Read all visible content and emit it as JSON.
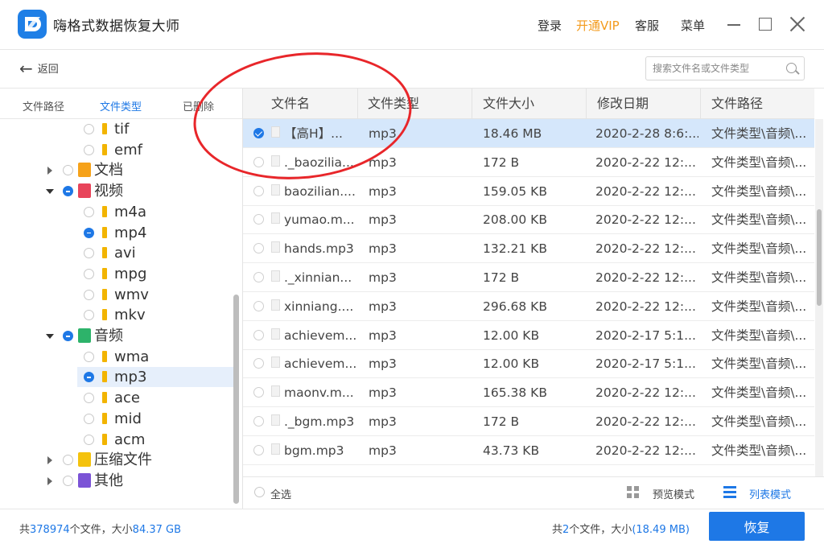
{
  "app": {
    "title": "嗨格式数据恢复大师"
  },
  "header": {
    "login": "登录",
    "vip": "开通VIP",
    "service": "客服",
    "menu": "菜单"
  },
  "toolbar": {
    "back": "返回",
    "search_placeholder": "搜索文件名或文件类型"
  },
  "sidebar": {
    "tabs": [
      "文件路径",
      "文件类型",
      "已删除"
    ],
    "active_tab": "文件类型",
    "tree": [
      {
        "label": "tif",
        "level": 2,
        "icon": "folder-icon"
      },
      {
        "label": "emf",
        "level": 2,
        "icon": "folder-icon"
      },
      {
        "label": "文档",
        "level": 1,
        "icon": "document-category-icon",
        "expanded": false
      },
      {
        "label": "视频",
        "level": 1,
        "icon": "video-category-icon",
        "expanded": true,
        "state": "partial"
      },
      {
        "label": "m4a",
        "level": 2,
        "icon": "folder-icon"
      },
      {
        "label": "mp4",
        "level": 2,
        "icon": "folder-icon",
        "state": "partial"
      },
      {
        "label": "avi",
        "level": 2,
        "icon": "folder-icon"
      },
      {
        "label": "mpg",
        "level": 2,
        "icon": "folder-icon"
      },
      {
        "label": "wmv",
        "level": 2,
        "icon": "folder-icon"
      },
      {
        "label": "mkv",
        "level": 2,
        "icon": "folder-icon"
      },
      {
        "label": "音频",
        "level": 1,
        "icon": "audio-category-icon",
        "expanded": true,
        "state": "partial"
      },
      {
        "label": "wma",
        "level": 2,
        "icon": "folder-icon"
      },
      {
        "label": "mp3",
        "level": 2,
        "icon": "folder-icon",
        "state": "partial",
        "selected": true
      },
      {
        "label": "ace",
        "level": 2,
        "icon": "folder-icon"
      },
      {
        "label": "mid",
        "level": 2,
        "icon": "folder-icon"
      },
      {
        "label": "acm",
        "level": 2,
        "icon": "folder-icon"
      },
      {
        "label": "压缩文件",
        "level": 1,
        "icon": "archive-category-icon",
        "expanded": false
      },
      {
        "label": "其他",
        "level": 1,
        "icon": "other-category-icon",
        "expanded": false
      }
    ]
  },
  "table": {
    "columns": [
      "文件名",
      "文件类型",
      "文件大小",
      "修改日期",
      "文件路径"
    ],
    "rows": [
      {
        "name": "【高H】...",
        "type": "mp3",
        "size": "18.46 MB",
        "date": "2020-2-28 8:6:...",
        "path": "文件类型\\音频\\...",
        "checked": true
      },
      {
        "name": "._baozilia...",
        "type": "mp3",
        "size": "172 B",
        "date": "2020-2-22 12:...",
        "path": "文件类型\\音频\\..."
      },
      {
        "name": "baozilian....",
        "type": "mp3",
        "size": "159.05 KB",
        "date": "2020-2-22 12:...",
        "path": "文件类型\\音频\\..."
      },
      {
        "name": "yumao.m...",
        "type": "mp3",
        "size": "208.00 KB",
        "date": "2020-2-22 12:...",
        "path": "文件类型\\音频\\..."
      },
      {
        "name": "hands.mp3",
        "type": "mp3",
        "size": "132.21 KB",
        "date": "2020-2-22 12:...",
        "path": "文件类型\\音频\\..."
      },
      {
        "name": "._xinnian...",
        "type": "mp3",
        "size": "172 B",
        "date": "2020-2-22 12:...",
        "path": "文件类型\\音频\\..."
      },
      {
        "name": "xinniang....",
        "type": "mp3",
        "size": "296.68 KB",
        "date": "2020-2-22 12:...",
        "path": "文件类型\\音频\\..."
      },
      {
        "name": "achievem...",
        "type": "mp3",
        "size": "12.00 KB",
        "date": "2020-2-17 5:1...",
        "path": "文件类型\\音频\\..."
      },
      {
        "name": "achievem...",
        "type": "mp3",
        "size": "12.00 KB",
        "date": "2020-2-17 5:1...",
        "path": "文件类型\\音频\\..."
      },
      {
        "name": "maonv.m...",
        "type": "mp3",
        "size": "165.38 KB",
        "date": "2020-2-22 12:...",
        "path": "文件类型\\音频\\..."
      },
      {
        "name": "._bgm.mp3",
        "type": "mp3",
        "size": "172 B",
        "date": "2020-2-22 12:...",
        "path": "文件类型\\音频\\..."
      },
      {
        "name": "bgm.mp3",
        "type": "mp3",
        "size": "43.73 KB",
        "date": "2020-2-22 12:...",
        "path": "文件类型\\音频\\..."
      }
    ]
  },
  "actionbar": {
    "select_all": "全选",
    "preview_mode": "预览模式",
    "list_mode": "列表模式"
  },
  "status": {
    "total_prefix": "共",
    "total_files": "378974",
    "total_mid": "个文件，大小",
    "total_size": "84.37 GB",
    "sel_prefix": "共",
    "sel_files": "2",
    "sel_mid": "个文件，大小",
    "sel_size": "(18.49 MB)",
    "recover": "恢复"
  },
  "colors": {
    "accent": "#1e78e6",
    "vip": "#f39a1c",
    "annotation": "#e8262a"
  }
}
